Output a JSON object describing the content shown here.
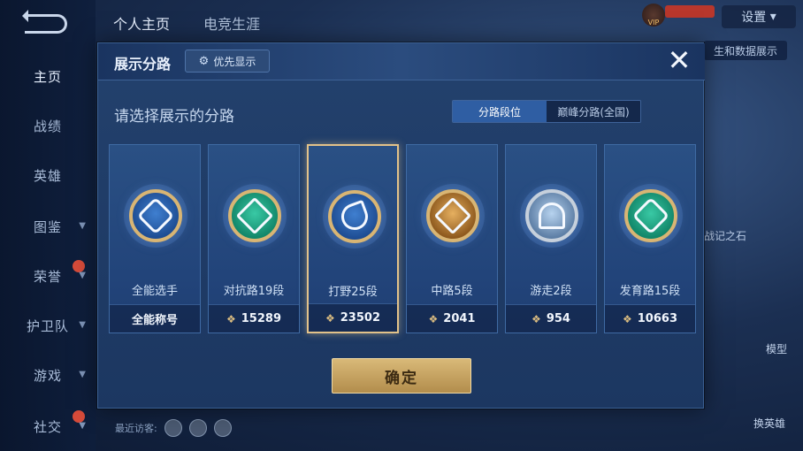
{
  "nav": {
    "items": [
      {
        "label": "主页",
        "active": true
      },
      {
        "label": "战绩"
      },
      {
        "label": "英雄"
      },
      {
        "label": "图鉴"
      },
      {
        "label": "荣誉"
      },
      {
        "label": "护卫队"
      },
      {
        "label": "游戏"
      },
      {
        "label": "社交"
      }
    ]
  },
  "top_tabs": [
    "个人主页",
    "电竞生涯"
  ],
  "header": {
    "settings_label": "设置"
  },
  "background": {
    "right_text": "生和数据展示",
    "right_text2": "战记之石",
    "model_label": "模型",
    "swap_label": "换英雄",
    "recent_visitors_label": "最近访客:"
  },
  "modal": {
    "title": "展示分路",
    "priority_label": "优先显示",
    "close_label": "✕",
    "subtitle": "请选择展示的分路",
    "segments": [
      {
        "label": "分路段位",
        "active": true
      },
      {
        "label": "巅峰分路(全国)",
        "active": false
      }
    ],
    "cards": [
      {
        "name": "全能选手",
        "value": "全能称号",
        "emblem": "allround-emblem-icon",
        "selected": false
      },
      {
        "name": "对抗路19段",
        "value": "15289",
        "emblem": "clash-lane-emblem-icon",
        "selected": false
      },
      {
        "name": "打野25段",
        "value": "23502",
        "emblem": "jungle-emblem-icon",
        "selected": true
      },
      {
        "name": "中路5段",
        "value": "2041",
        "emblem": "mid-lane-emblem-icon",
        "selected": false
      },
      {
        "name": "游走2段",
        "value": "954",
        "emblem": "roam-emblem-icon",
        "selected": false
      },
      {
        "name": "发育路15段",
        "value": "10663",
        "emblem": "farm-lane-emblem-icon",
        "selected": false
      }
    ],
    "confirm_label": "确定"
  },
  "colors": {
    "accent_gold": "#d9b978",
    "segment_active": "#2f5ea3",
    "modal_bg": "#23416d"
  }
}
